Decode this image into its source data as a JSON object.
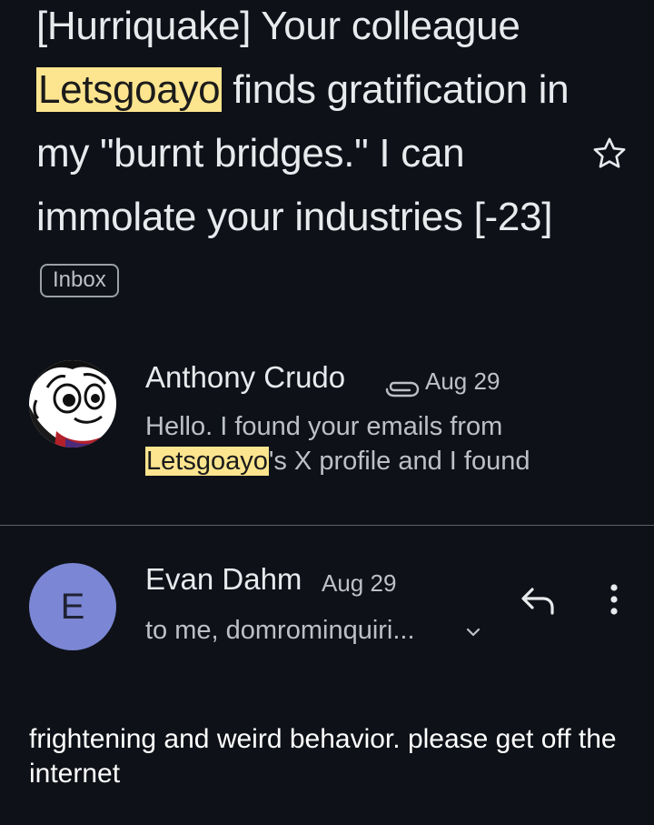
{
  "thread": {
    "subject_lines": {
      "part1": "[Hurriquake] Your colleague ",
      "highlight": "Letsgoayo",
      "part2": " finds gratification in my \"burnt bridges.\" I can immolate your industries [-23]"
    },
    "label_chip": "Inbox",
    "star_icon": "star-outline-icon"
  },
  "messages": [
    {
      "sender": "Anthony Crudo",
      "has_attachment": true,
      "attachment_icon": "paperclip-icon",
      "date": "Aug 29",
      "snippet_before": "Hello. I found your emails from ",
      "snippet_highlight": "Letsgoayo",
      "snippet_after": "'s X profile and I found"
    },
    {
      "sender": "Evan Dahm",
      "avatar_letter": "E",
      "avatar_color": "#7b86d4",
      "date": "Aug 29",
      "recipients": "to me, domrominquiri...",
      "body": "frightening and weird behavior. please get off the internet",
      "reply_icon": "reply-icon",
      "more_icon": "more-vert-icon",
      "expand_icon": "chevron-down-icon"
    }
  ],
  "colors": {
    "background": "#0e1117",
    "highlight": "#fde58f",
    "text_primary": "#e8eaed",
    "text_secondary": "#bdc1c6"
  }
}
